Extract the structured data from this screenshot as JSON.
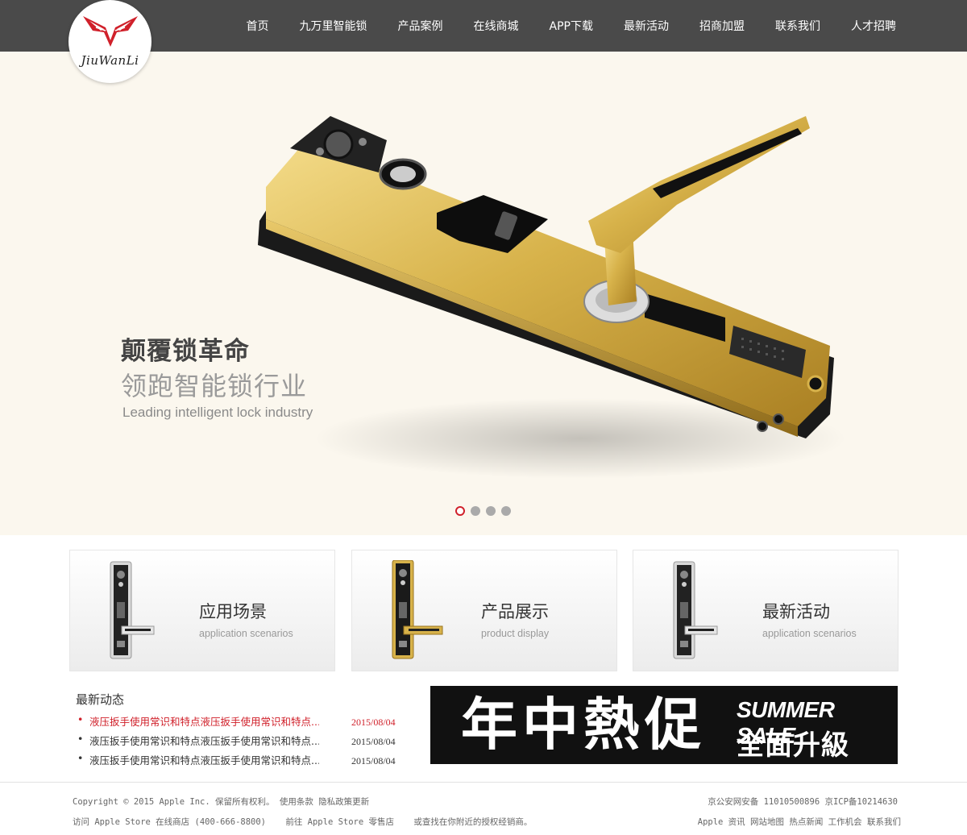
{
  "header": {
    "logo_text": "JiuWanLi",
    "nav": [
      "首页",
      "九万里智能锁",
      "产品案例",
      "在线商城",
      "APP下载",
      "最新活动",
      "招商加盟",
      "联系我们",
      "人才招聘"
    ]
  },
  "hero": {
    "title": "颠覆锁革命",
    "subtitle": "领跑智能锁行业",
    "english": "Leading intelligent lock industry",
    "slides": 4,
    "active_slide": 1
  },
  "cards": [
    {
      "title": "应用场景",
      "subtitle": "application scenarios",
      "lock_color": "silver"
    },
    {
      "title": "产品展示",
      "subtitle": "product display",
      "lock_color": "gold"
    },
    {
      "title": "最新活动",
      "subtitle": "application scenarios",
      "lock_color": "silver"
    }
  ],
  "news": {
    "heading": "最新动态",
    "items": [
      {
        "text": "液压扳手使用常识和特点液压扳手使用常识和特点...",
        "date": "2015/08/04",
        "color": "#d0202a"
      },
      {
        "text": "液压扳手使用常识和特点液压扳手使用常识和特点...",
        "date": "2015/08/04",
        "color": "#333333"
      },
      {
        "text": "液压扳手使用常识和特点液压扳手使用常识和特点...",
        "date": "2015/08/04",
        "color": "#333333"
      }
    ]
  },
  "promo": {
    "cn_big": "年中熱促",
    "en": "SUMMER SALE",
    "cn_small": "全面升級"
  },
  "footer": {
    "copyright": "Copyright © 2015 Apple Inc. 保留所有权利。",
    "links_left": [
      "使用条款",
      "隐私政策更新"
    ],
    "visit_text": "访问 Apple Store 在线商店 (400-666-8800)",
    "goto_text": "前往 Apple Store 零售店",
    "find_text": "或查找在你附近的授权经销商。",
    "record": "京公安网安备 11010500896 京ICP备10214630",
    "links_right": [
      "Apple 资讯",
      "网站地图",
      "热点新闻",
      "工作机会",
      "联系我们"
    ]
  },
  "colors": {
    "header_bg": "#4a4a4a",
    "hero_bg": "#fbf7ee",
    "accent_red": "#d0202a",
    "lock_gold": "#d7b24a",
    "promo_bg": "#111111"
  }
}
